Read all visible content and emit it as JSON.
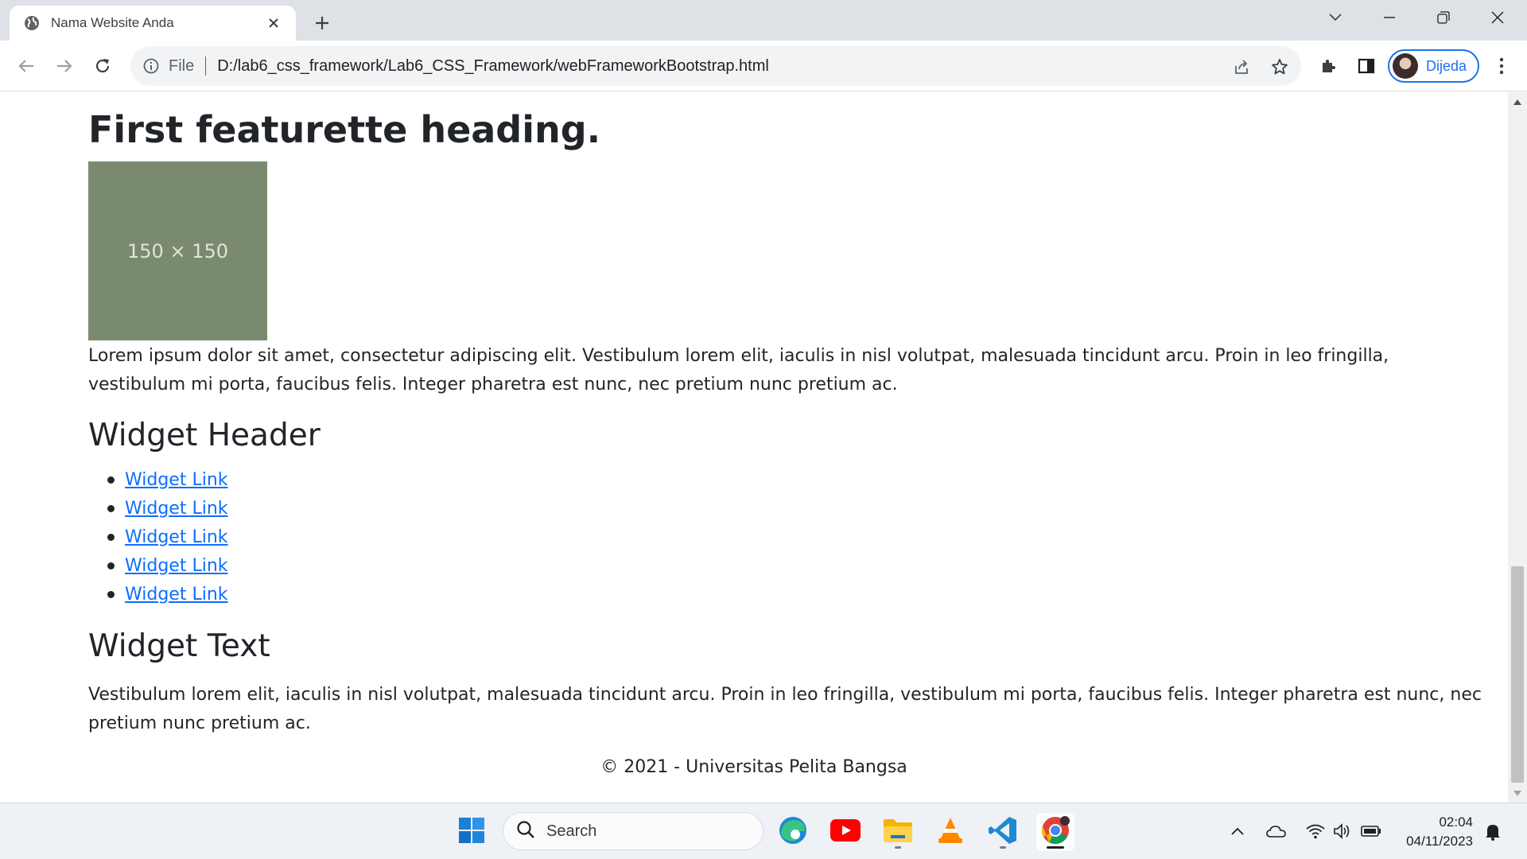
{
  "browser": {
    "tab_title": "Nama Website Anda",
    "url_scheme": "File",
    "url": "D:/lab6_css_framework/Lab6_CSS_Framework/webFrameworkBootstrap.html",
    "profile_name": "Dijeda"
  },
  "page": {
    "featurette_heading": "First featurette heading.",
    "placeholder_label": "150 × 150",
    "featurette_text_line1": "Lorem ipsum dolor sit amet, consectetur adipiscing elit. Vestibulum lorem elit, iaculis in nisl volutpat, malesuada tincidunt arcu. Proin in leo fringilla,",
    "featurette_text_line2": "vestibulum mi porta, faucibus felis. Integer pharetra est nunc, nec pretium nunc pretium ac.",
    "widget_header": "Widget Header",
    "widget_links": [
      "Widget Link",
      "Widget Link",
      "Widget Link",
      "Widget Link",
      "Widget Link"
    ],
    "widget_text_heading": "Widget Text",
    "widget_text_line1": "Vestibulum lorem elit, iaculis in nisl volutpat, malesuada tincidunt arcu. Proin in leo fringilla, vestibulum mi porta, faucibus felis. Integer pharetra est nunc, nec",
    "widget_text_line2": "pretium nunc pretium ac.",
    "footer": "© 2021 - Universitas Pelita Bangsa"
  },
  "taskbar": {
    "search_label": "Search",
    "time": "02:04",
    "date": "04/11/2023",
    "apps": [
      "windows-start",
      "edge",
      "youtube",
      "file-explorer",
      "vlc",
      "vscode",
      "chrome"
    ]
  },
  "colors": {
    "link": "#0d6efd",
    "text": "#212529",
    "placeholder_bg": "#7a8a6e",
    "profile_accent": "#1a73e8"
  }
}
